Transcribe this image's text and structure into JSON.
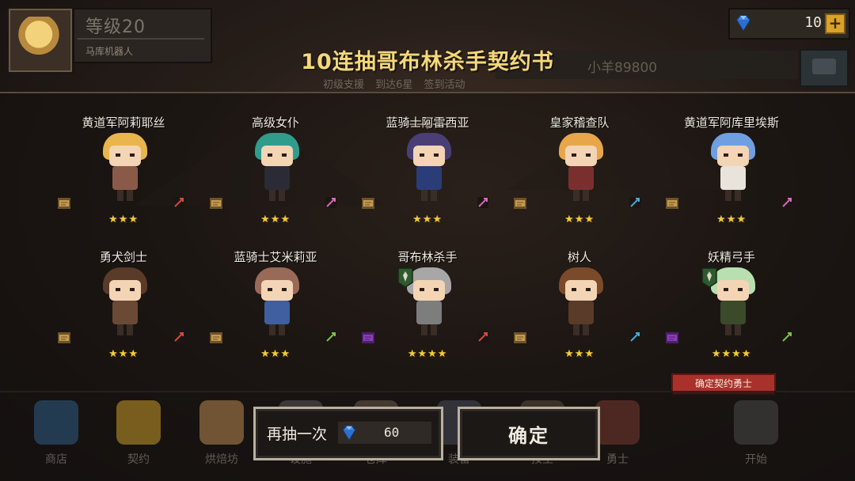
{
  "hud": {
    "level": "等级20",
    "guild": "马库机器人",
    "gems": "10",
    "plus": "+",
    "chat_text": "小羊89800"
  },
  "panel": {
    "title": "10连抽哥布林杀手契约书",
    "ghost_tabs": "初级支援 到达6星 签到活动"
  },
  "results": [
    {
      "name": "黄道军阿莉耶丝",
      "stars": "★★★",
      "hair": "#e8b64c",
      "body": "#8a5a48",
      "scroll": "gold",
      "class_icon": "sword-icon",
      "class_color": "#d9473e"
    },
    {
      "name": "高级女仆",
      "stars": "★★★",
      "hair": "#2f9c8c",
      "body": "#2b2b36",
      "scroll": "gold",
      "class_icon": "staff-icon",
      "class_color": "#d66ab8"
    },
    {
      "name": "蓝骑士阿雷西亚",
      "stars": "★★★",
      "hair": "#4a3f75",
      "body": "#2a3d79",
      "scroll": "gold",
      "class_icon": "staff-icon",
      "class_color": "#d66ab8"
    },
    {
      "name": "皇家稽查队",
      "stars": "★★★",
      "hair": "#e8a64a",
      "body": "#7a2f2f",
      "scroll": "gold",
      "class_icon": "shield-icon",
      "class_color": "#4aa7d9"
    },
    {
      "name": "黄道军阿库里埃斯",
      "stars": "★★★",
      "hair": "#6f9fe0",
      "body": "#e8e4dc",
      "scroll": "gold",
      "class_icon": "staff-icon",
      "class_color": "#d66ab8"
    },
    {
      "name": "勇犬剑士",
      "stars": "★★★",
      "hair": "#5a3a28",
      "body": "#6a4a34",
      "scroll": "gold",
      "class_icon": "sword-icon",
      "class_color": "#d9473e"
    },
    {
      "name": "蓝骑士艾米莉亚",
      "stars": "★★★",
      "hair": "#9a6a58",
      "body": "#3f5fa0",
      "scroll": "gold",
      "class_icon": "bow-icon",
      "class_color": "#7fbf4a"
    },
    {
      "name": "哥布林杀手",
      "stars": "★★★★",
      "hair": "#a7a7a7",
      "body": "#7d7d7d",
      "scroll": "purple",
      "class_icon": "sword-icon",
      "class_color": "#d9473e",
      "has_badge": true
    },
    {
      "name": "树人",
      "stars": "★★★",
      "hair": "#7a4a2a",
      "body": "#5a3a28",
      "scroll": "gold",
      "class_icon": "shield-icon",
      "class_color": "#4aa7d9"
    },
    {
      "name": "妖精弓手",
      "stars": "★★★★",
      "hair": "#b8dfb0",
      "body": "#3a4a2a",
      "scroll": "purple",
      "class_icon": "bow-icon",
      "class_color": "#7fbf4a",
      "has_badge": true
    }
  ],
  "ribbon": "确定契约勇士",
  "buttons": {
    "again_label": "再抽一次",
    "again_cost": "60",
    "confirm_label": "确定"
  },
  "nav": [
    "商店",
    "契约",
    "烘焙坊",
    "设施",
    "仓库",
    "装备",
    "按主",
    "勇士",
    "开始"
  ],
  "colors": {
    "title": "#f4d87a",
    "star": "#f1cc3a",
    "ribbon": "#a9312c"
  }
}
